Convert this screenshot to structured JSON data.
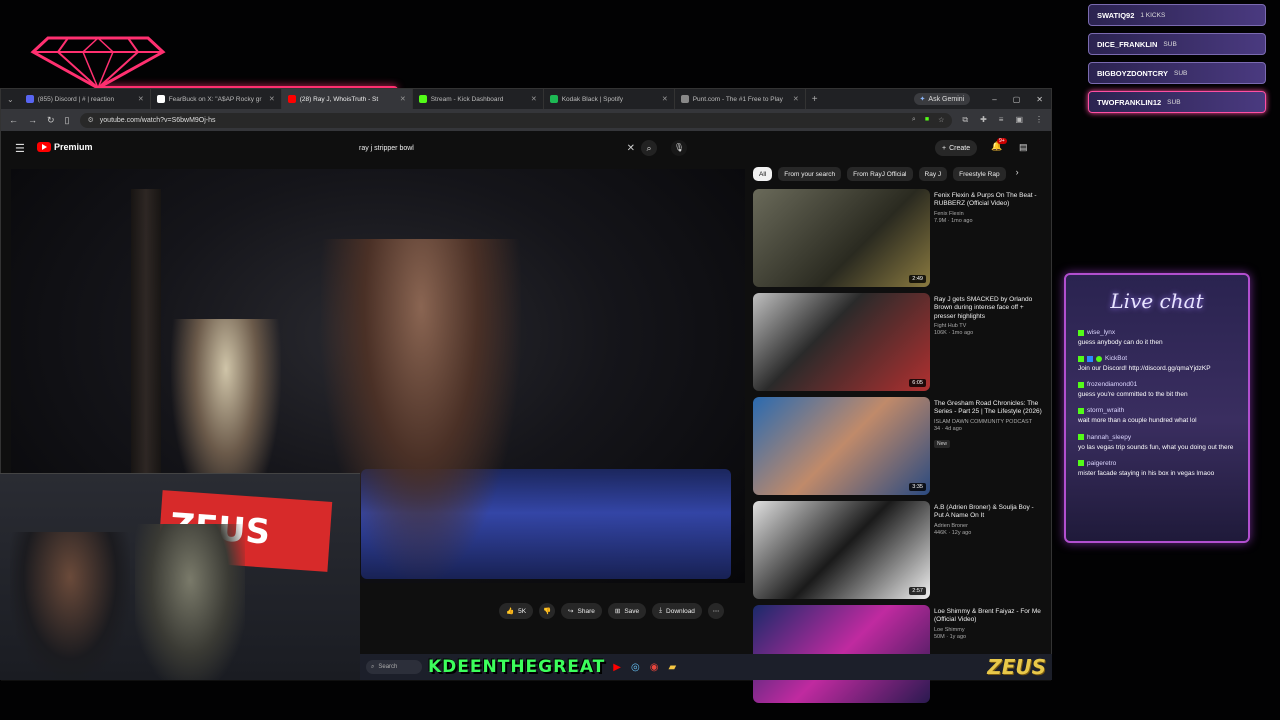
{
  "browser": {
    "tabs": [
      {
        "title": "(855) Discord | #​ | reaction",
        "color": "#5865f2",
        "active": false
      },
      {
        "title": "FearBuck on X: \"A$AP Rocky gr",
        "color": "#ffffff",
        "active": false
      },
      {
        "title": "(28) Ray J, WhoisTruth - St",
        "color": "#ff0000",
        "active": true
      },
      {
        "title": "Stream - Kick Dashboard",
        "color": "#53fc18",
        "active": false
      },
      {
        "title": "Kodak Black | Spotify",
        "color": "#1db954",
        "active": false
      },
      {
        "title": "Punt.com - The #1 Free to Play",
        "color": "#888888",
        "active": false
      }
    ],
    "new_tab": "+",
    "gemini_label": "Ask Gemini",
    "url": "youtube.com/watch?v=S6bwM9Oj-hs"
  },
  "youtube": {
    "brand": "Premium",
    "search_value": "ray j stripper bowl",
    "create_label": "Create",
    "notif_count": "9+",
    "chips": [
      "All",
      "From your search",
      "From RayJ Official",
      "Ray J",
      "Freestyle Rap"
    ],
    "actions": {
      "like_count": "5K",
      "share": "Share",
      "save": "Save",
      "download": "Download"
    },
    "recs": [
      {
        "title": "Fenix Flexin & Purps On The Beat - RUBBERZ (Official Video)",
        "channel": "Fenix Flexin",
        "meta": "7.9M · 1mo ago",
        "duration": "2:49",
        "badge": ""
      },
      {
        "title": "Ray J gets SMACKED by Orlando Brown during intense face off + presser highlights",
        "channel": "Fight Hub TV",
        "meta": "106K · 1mo ago",
        "duration": "6:05",
        "badge": ""
      },
      {
        "title": "The Gresham Road Chronicles: The Series - Part 25 | The Lifestyle (2026)",
        "channel": "ISLAM DAWN COMMUNITY PODCAST",
        "meta": "34 · 4d ago",
        "duration": "3:35",
        "badge": "New"
      },
      {
        "title": "A.B (Adrien Broner) & Soulja Boy - Put A Name On It",
        "channel": "Adrien Broner",
        "meta": "446K · 12y ago",
        "duration": "2:57",
        "badge": ""
      },
      {
        "title": "Loe Shimmy & Brent Faiyaz - For Me (Official Video)",
        "channel": "Loe Shimmy",
        "meta": "50M · 1y ago",
        "duration": "",
        "badge": ""
      }
    ]
  },
  "taskbar": {
    "search_placeholder": "Search",
    "streamer": "KDEENTHEGREAT",
    "sponsor": "ZEUS"
  },
  "webcam": {
    "banner": "ZEUS"
  },
  "subs": [
    {
      "user": "SWATIQ92",
      "type": "1 KICKS"
    },
    {
      "user": "DICE_FRANKLIN",
      "type": "SUB"
    },
    {
      "user": "BIGBOYZDONTCRY",
      "type": "SUB"
    },
    {
      "user": "TWOFRANKLIN12",
      "type": "SUB"
    }
  ],
  "chat": {
    "title": "Live chat",
    "messages": [
      {
        "user": "wise_lynx",
        "text": "guess anybody can do it then"
      },
      {
        "user": "KickBot",
        "text": "Join our Discord! http://discord.gg/qmaYjdzKP"
      },
      {
        "user": "frozendiamond01",
        "text": "guess you're committed to the bit then"
      },
      {
        "user": "storm_wraith",
        "text": "wait more than a couple hundred what lol"
      },
      {
        "user": "hannah_sleepy",
        "text": "yo las vegas trip sounds fun, what you doing out there"
      },
      {
        "user": "paigeretro",
        "text": "mister facade staying in his box in vegas lmaoo"
      }
    ]
  }
}
